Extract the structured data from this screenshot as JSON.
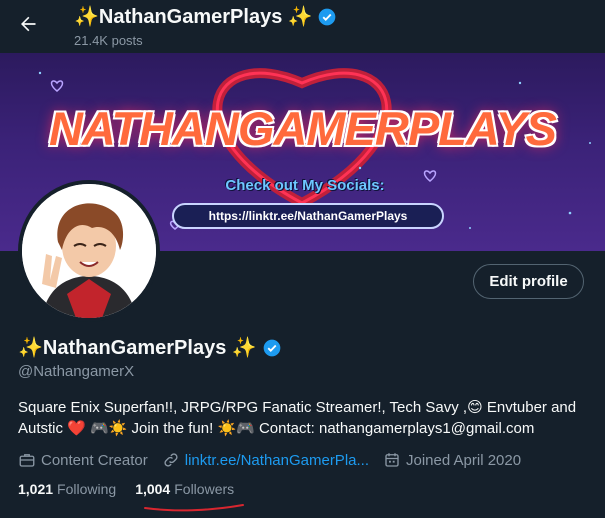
{
  "header": {
    "title": "✨NathanGamerPlays ✨",
    "posts": "21.4K posts",
    "back_icon": "arrow-left-icon"
  },
  "banner": {
    "title": "NATHANGAMERPLAYS",
    "cta": "Check out My Socials:",
    "link": "https://linktr.ee/NathanGamerPlays"
  },
  "profile": {
    "name": "✨NathanGamerPlays ✨",
    "handle": "@NathangamerX",
    "verified_color": "#1d9bf0",
    "bio_line1": "Square Enix Superfan!!, JRPG/RPG Fanatic Streamer!, Tech Savy ,😊 Envtuber and",
    "bio_line2": "Autstic ❤️ 🎮☀️ Join the fun! ☀️🎮 Contact: nathangamerplays1@gmail.com",
    "category": "Content Creator",
    "website": "linktr.ee/NathanGamerPla...",
    "joined": "Joined April 2020",
    "following_count": "1,021",
    "following_label": "Following",
    "followers_count": "1,004",
    "followers_label": "Followers"
  },
  "actions": {
    "edit_profile": "Edit profile"
  }
}
